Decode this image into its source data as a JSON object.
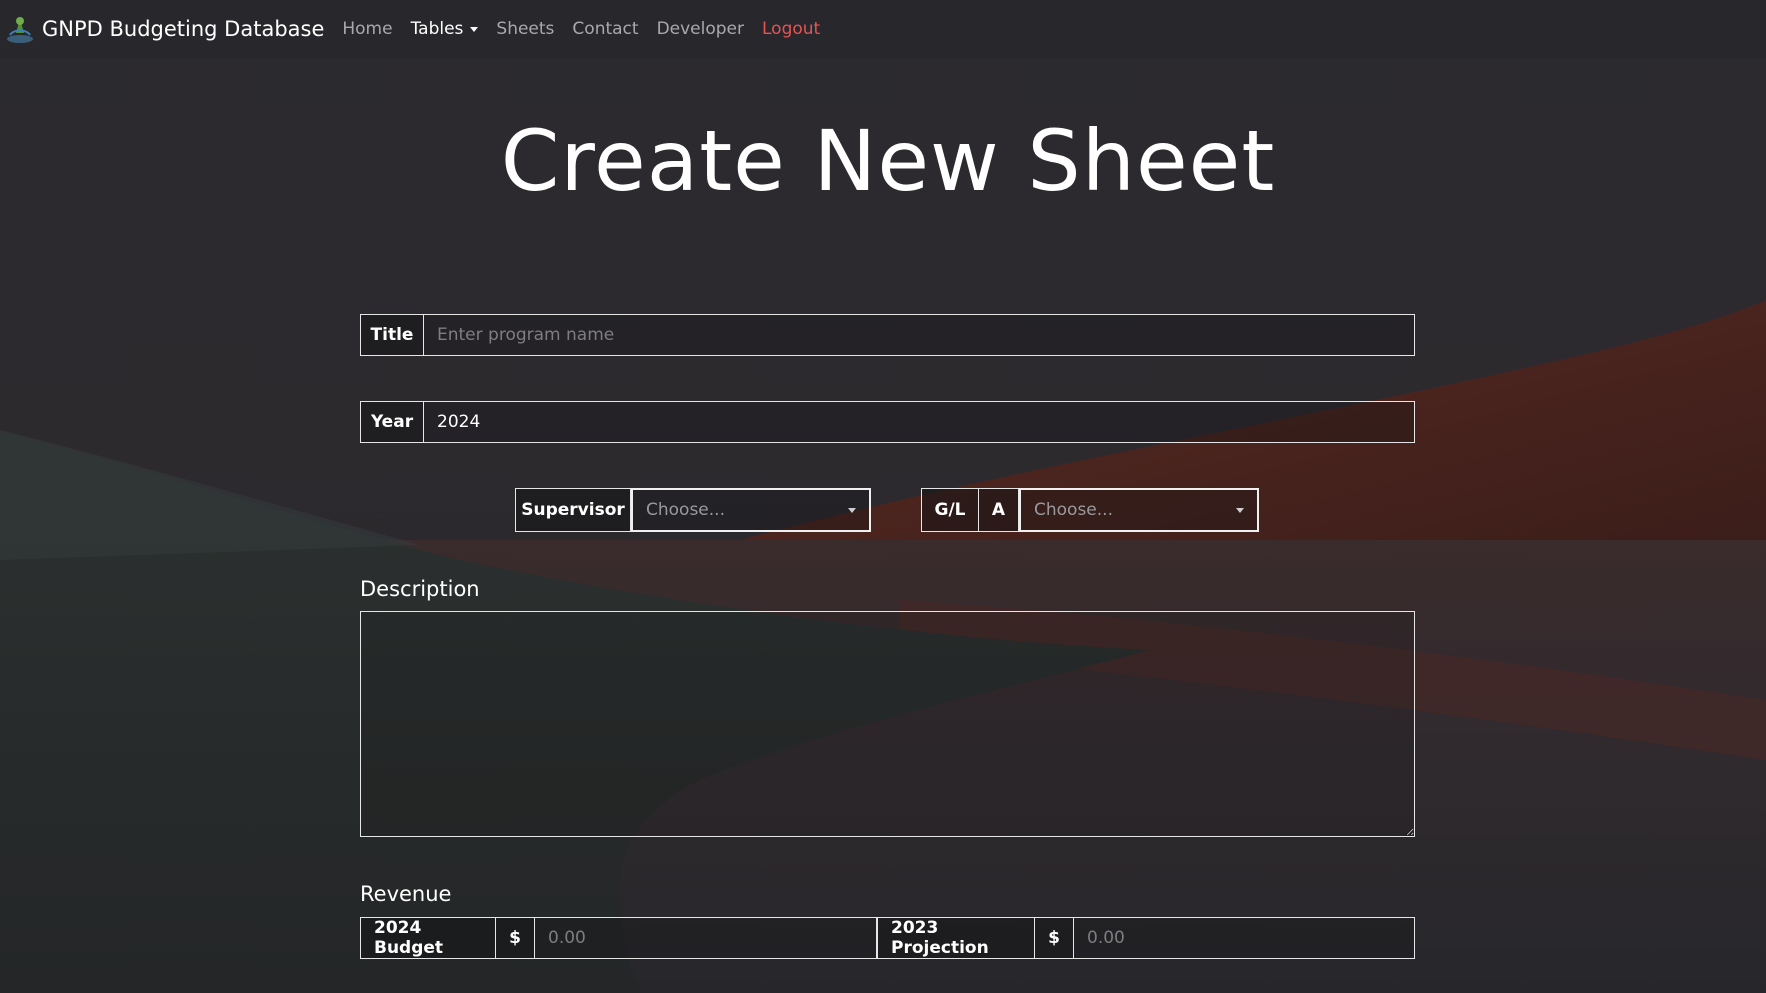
{
  "navbar": {
    "brand": "GNPD Budgeting Database",
    "links": {
      "home": "Home",
      "tables": "Tables",
      "sheets": "Sheets",
      "contact": "Contact",
      "developer": "Developer",
      "logout": "Logout"
    }
  },
  "page": {
    "title": "Create New Sheet"
  },
  "form": {
    "title_label": "Title",
    "title_placeholder": "Enter program name",
    "title_value": "",
    "year_label": "Year",
    "year_value": "2024",
    "supervisor_label": "Supervisor",
    "supervisor_selected": "Choose...",
    "gl_label": "G/L",
    "gl_prefix": "A",
    "gl_selected": "Choose...",
    "description_label": "Description",
    "description_value": "",
    "revenue_label": "Revenue",
    "budget_label": "2024 Budget",
    "budget_currency": "$",
    "budget_placeholder": "0.00",
    "projection_label": "2023 Projection",
    "projection_currency": "$",
    "projection_placeholder": "0.00"
  },
  "colors": {
    "logout": "#e55354",
    "nav_inactive": "#a9a9ad",
    "background": "#2b2a2e"
  }
}
